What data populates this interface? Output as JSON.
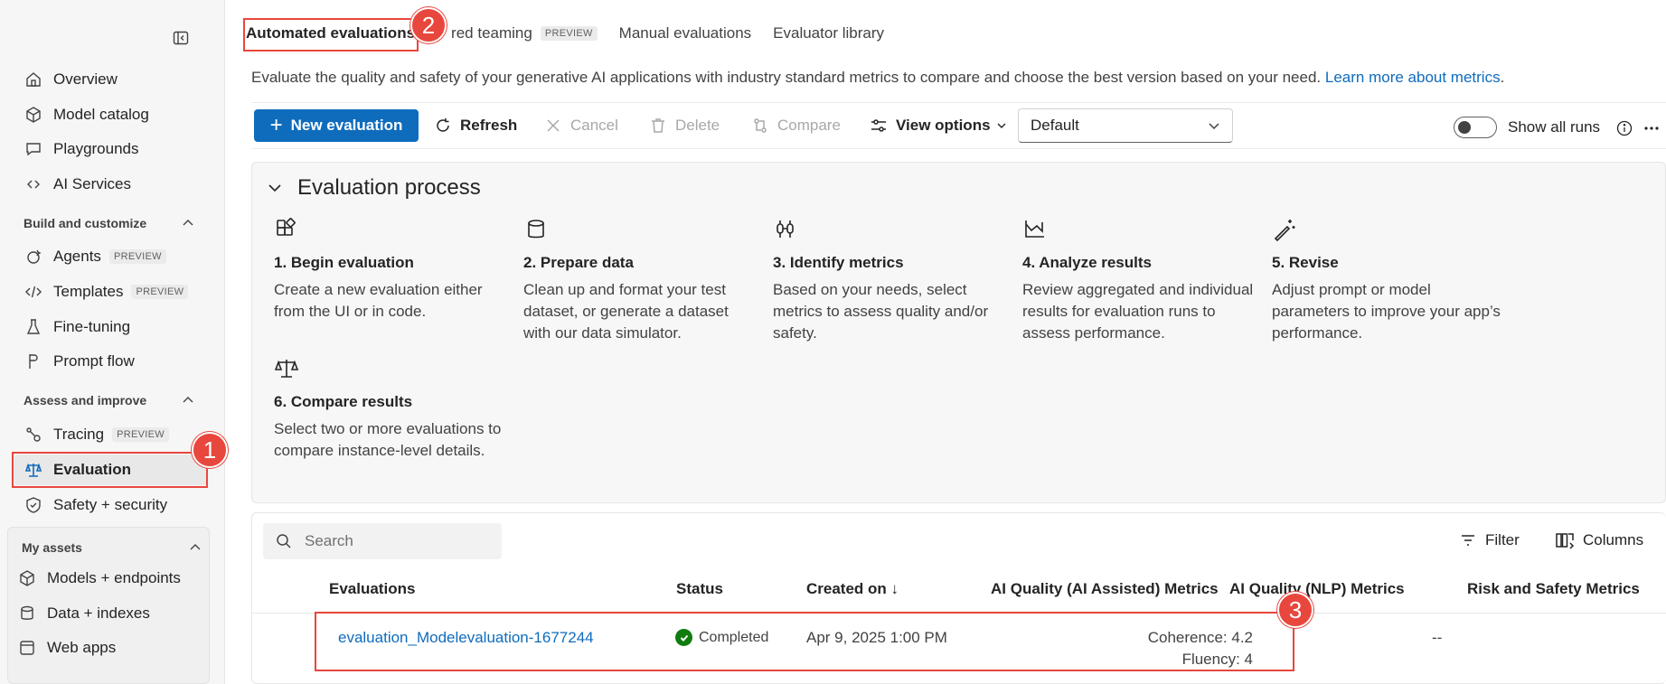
{
  "sidebar": {
    "top_items": [
      {
        "label": "Overview",
        "icon": "home-icon"
      },
      {
        "label": "Model catalog",
        "icon": "cube-icon"
      },
      {
        "label": "Playgrounds",
        "icon": "chat-icon"
      },
      {
        "label": "AI Services",
        "icon": "link-icon"
      }
    ],
    "build_section": "Build and customize",
    "build_items": [
      {
        "label": "Agents",
        "badge": "PREVIEW"
      },
      {
        "label": "Templates",
        "badge": "PREVIEW"
      },
      {
        "label": "Fine-tuning"
      },
      {
        "label": "Prompt flow"
      }
    ],
    "assess_section": "Assess and improve",
    "assess_items": [
      {
        "label": "Tracing",
        "badge": "PREVIEW"
      },
      {
        "label": "Evaluation"
      },
      {
        "label": "Safety + security"
      }
    ],
    "assets_section": "My assets",
    "assets_items": [
      {
        "label": "Models + endpoints"
      },
      {
        "label": "Data + indexes"
      },
      {
        "label": "Web apps"
      }
    ]
  },
  "tabs": [
    {
      "label": "Automated evaluations"
    },
    {
      "label": "red teaming",
      "badge": "PREVIEW"
    },
    {
      "label": "Manual evaluations"
    },
    {
      "label": "Evaluator library"
    }
  ],
  "description": {
    "text": "Evaluate the quality and safety of your generative AI applications with industry standard metrics to compare and choose the best version based on your need. ",
    "link": "Learn more about metrics",
    "end": "."
  },
  "toolbar": {
    "new_evaluation": "New evaluation",
    "refresh": "Refresh",
    "cancel": "Cancel",
    "delete": "Delete",
    "compare": "Compare",
    "view_options": "View options",
    "view_select": "Default",
    "show_all_runs": "Show all runs"
  },
  "process": {
    "title": "Evaluation process",
    "steps": [
      {
        "title": "1. Begin evaluation",
        "desc": "Create a new evaluation either from the UI or in code."
      },
      {
        "title": "2. Prepare data",
        "desc": "Clean up and format your test dataset, or generate a dataset with our data simulator."
      },
      {
        "title": "3. Identify metrics",
        "desc": "Based on your needs, select metrics to assess quality and/or safety."
      },
      {
        "title": "4. Analyze results",
        "desc": "Review aggregated and individual results for evaluation runs to assess performance."
      },
      {
        "title": "5. Revise",
        "desc": "Adjust prompt or model parameters to improve your app’s performance."
      },
      {
        "title": "6. Compare results",
        "desc": "Select two or more evaluations to compare instance-level details."
      }
    ]
  },
  "runs": {
    "search_placeholder": "Search",
    "filter": "Filter",
    "columns": "Columns",
    "headers": [
      "Evaluations",
      "Status",
      "Created on ↓",
      "AI Quality (AI Assisted) Metrics",
      "AI Quality (NLP) Metrics",
      "Risk and Safety Metrics"
    ],
    "rows": [
      {
        "name": "evaluation_Modelevaluation-1677244",
        "status": "Completed",
        "created": "Apr 9, 2025 1:00 PM",
        "ai_assisted": [
          "Coherence: 4.2",
          "Fluency: 4"
        ],
        "nlp": "--"
      }
    ]
  },
  "annotations": [
    "1",
    "2",
    "3"
  ],
  "colors": {
    "accent": "#0f6cbd",
    "highlight": "#e8473d",
    "success": "#107c10"
  }
}
